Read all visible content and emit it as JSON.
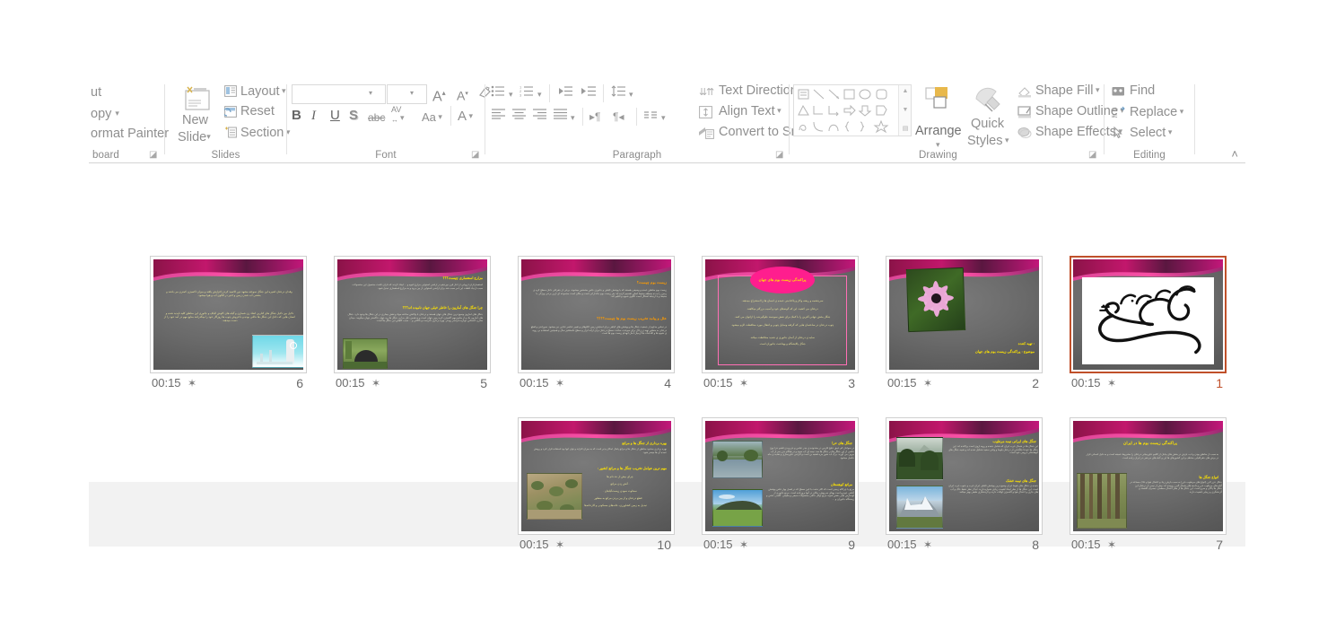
{
  "application": {
    "name": "PowerPoint",
    "view": "Slide Sorter"
  },
  "ribbon": {
    "groups": [
      {
        "name": "Clipboard",
        "label": "board",
        "items": [
          {
            "label": "ut",
            "icon": "cut-icon"
          },
          {
            "label": "opy",
            "icon": "copy-icon",
            "dropdown": true
          },
          {
            "label": "ormat Painter",
            "icon": "format-painter-icon"
          }
        ]
      },
      {
        "name": "Slides",
        "label": "Slides",
        "items": [
          {
            "label": "New",
            "label2": "Slide",
            "icon": "new-slide-icon",
            "dropdown": true
          },
          {
            "label": "Layout",
            "icon": "layout-icon",
            "dropdown": true
          },
          {
            "label": "Reset",
            "icon": "reset-icon",
            "dropdown": false
          },
          {
            "label": "Section",
            "icon": "section-icon",
            "dropdown": true
          }
        ]
      },
      {
        "name": "Font",
        "label": "Font",
        "font_name_value": "",
        "font_size_value": "",
        "buttons": [
          {
            "label": "A",
            "icon": "increase-font-size-icon"
          },
          {
            "label": "A",
            "icon": "decrease-font-size-icon"
          },
          {
            "label": "",
            "icon": "clear-formatting-icon"
          },
          {
            "label": "B",
            "icon": "bold-icon"
          },
          {
            "label": "I",
            "icon": "italic-icon"
          },
          {
            "label": "U",
            "icon": "underline-icon"
          },
          {
            "label": "S",
            "icon": "text-shadow-icon"
          },
          {
            "label": "abc",
            "icon": "strikethrough-icon"
          },
          {
            "label": "AV",
            "icon": "character-spacing-icon"
          },
          {
            "label": "Aa",
            "icon": "change-case-icon"
          },
          {
            "label": "A",
            "icon": "font-color-icon"
          }
        ]
      },
      {
        "name": "Paragraph",
        "label": "Paragraph",
        "items": [
          {
            "label": "Text Direction",
            "icon": "text-direction-icon",
            "dropdown": true
          },
          {
            "label": "Align Text",
            "icon": "align-text-icon",
            "dropdown": true
          },
          {
            "label": "Convert to SmartArt",
            "icon": "convert-to-smartart-icon",
            "dropdown": true
          }
        ],
        "buttons": [
          {
            "icon": "bullets-icon"
          },
          {
            "icon": "numbering-icon"
          },
          {
            "icon": "decrease-indent-icon"
          },
          {
            "icon": "increase-indent-icon"
          },
          {
            "icon": "line-spacing-icon"
          },
          {
            "icon": "align-left-icon"
          },
          {
            "icon": "align-center-icon"
          },
          {
            "icon": "align-right-icon"
          },
          {
            "icon": "justify-icon"
          },
          {
            "icon": "ltr-text-icon"
          },
          {
            "icon": "rtl-text-icon"
          },
          {
            "icon": "columns-icon"
          }
        ]
      },
      {
        "name": "Drawing",
        "label": "Drawing",
        "items": [
          {
            "label": "Arrange",
            "icon": "arrange-icon",
            "dropdown": true
          },
          {
            "label": "Quick",
            "label2": "Styles",
            "icon": "quick-styles-icon",
            "dropdown": true
          },
          {
            "label": "Shape Fill",
            "icon": "shape-fill-icon",
            "dropdown": true
          },
          {
            "label": "Shape Outline",
            "icon": "shape-outline-icon",
            "dropdown": true
          },
          {
            "label": "Shape Effects",
            "icon": "shape-effects-icon",
            "dropdown": true
          }
        ]
      },
      {
        "name": "Editing",
        "label": "Editing",
        "items": [
          {
            "label": "Find",
            "icon": "find-icon",
            "dropdown": false
          },
          {
            "label": "Replace",
            "icon": "replace-icon",
            "dropdown": true
          },
          {
            "label": "Select",
            "icon": "select-icon",
            "dropdown": true
          }
        ]
      }
    ],
    "collapse_icon": "chevron-up-icon"
  },
  "theme": {
    "accent_magenta": "#ff1e8e",
    "accent_yellow": "#ffe400",
    "accent_orange": "#ff9c00",
    "selection_border": "#c0502a",
    "slide_bg_dark": "#6a6a6a",
    "panel_bg": "#f2f2f2"
  },
  "slides": [
    {
      "number": "6",
      "timing": "00:15",
      "transition_icon": "transition-star-icon",
      "selected": false,
      "layout": "text-with-image-bottom-right",
      "paragraphs": [
        "وقدان درختان اشیره این جنگل سوخته مشهد دور الاسید کردن افزایش یافته و میزان اکسیژن کمتری می باشد و بخشی آب شدن زمین و اخیر در الگوی آب و هوا میشود.",
        "دلایل بین دلایل جنگل های کنارین اتحاد زن شماری و گیاه های کاوش الیاف و جانوری این مناطق کلید ناپدید شده و انسان هایی که داخل این جنگل ها حالتی بوده و با فروش چوب ها روزگار خود را میگذرانند منابع مهم در آمد خود را از دست میدهند."
      ],
      "image": {
        "name": "blue-cyan-graphic",
        "alt": "cyan industrial graphic"
      }
    },
    {
      "number": "5",
      "timing": "00:15",
      "transition_icon": "transition-star-icon",
      "selected": false,
      "layout": "two-headings-with-image",
      "headings": [
        "مزارع استعماری چیست؟؟؟",
        "چرا جنگل های آمازون را خاطر خیلی جهان نامیده اند؟؟؟"
      ],
      "paragraphs": [
        "استعمارگران اروپایی از آغاز قرن نوزدهم در اراضی استوایی مزارع انبوه و ... ایجاد کردند که دارای کشت محصول این محصولات سبب ازدیاد غلظت این امر سبب شد برای اراضی استوایی از بین برود و به مزارع استعماری تبدیل شود.",
        "جنگل های آمازون وسیع ترین جنگل های جهان هستند و درختان با واکنش ساخته مواد و نقش بیماری در این جنگل ها وجود دارد. جنگل های آمازون یک و از منابع مهم اکسیژن کره زمین جهان است و به همین دلیل به این جنگل ها ریه جهان خاکستر جهان میگویند. میدان مخزن احساس دوباره سراسر زودتر. بهره برداری نادرست و ناکافی و ... سبب کاهش این جنگل ها است."
      ],
      "image": {
        "name": "dome-structure-photo",
        "alt": "dome in greenery"
      }
    },
    {
      "number": "4",
      "timing": "00:15",
      "transition_icon": "transition-star-icon",
      "selected": false,
      "layout": "two-headings-text-only",
      "headings": [
        "زیست بوم چیست؟",
        "علل و پیامد تخریب زیست بوم ها چیست؟؟؟؟"
      ],
      "paragraphs": [
        "زیست بوم مناطق عمده و وسیعی هستند که با پوشش گیاهی و جانوری خاص مشخص میشوند. برخی از جغرافی دانان سطح کره ی زمین را به ده منطقه محیط اصلی تقسیم کرده اند. هر زیست بوم جاندارانی است و مکان است مجموعه ای ازین برخی ویژگی با محیط و با ارتباط اشکال است الگوی شیوه و اقلیم کند.",
        "در تماس مداوم از جمعیت جنگل ها و پوشش های گیاهی برای آسایش زمین الگوهای و تغییر عناصر غذایی نیز میشود. سوزاندن و قطع درختان به منظور تهیه ی زغال برای سوخت، ساخت سطح درختان برای ارائه ابزار و سطح حاصلخیز سال و همچنین استفاده بی رویه ی شیوه ها و اقدامات ها ازمیان امان انهدام زیست بوم ها است."
      ]
    },
    {
      "number": "3",
      "timing": "00:15",
      "transition_icon": "transition-star-icon",
      "selected": false,
      "layout": "ellipse-title-with-bullets",
      "title": "پراکندگی زیست بوم های جهان",
      "bullets": [
        "سرچشمه و ریشه وکار و پاکدامنی عمده ی انسان ها را استخراج میدهند.",
        "درختان می کشید، این که گونه‌های خود و آسیب بزرگتر میکاهند.",
        "جنگل بخش جهانی آفرین را با کمک برای نقش سودمند جلوگیرنده را ازاتوان می کنند.",
        "چوب درختان در ساختمان هایی که گرفته وسایل چوبی و انتقال مورد محافظت الزم میشود.",
        "سایه ی درختان از آسان جانوری ی شدید محافظت میکند.",
        "جنگل پالایشگاه و بهداشت جانوران است."
      ]
    },
    {
      "number": "2",
      "timing": "00:15",
      "transition_icon": "transition-star-icon",
      "selected": false,
      "layout": "title-slide-with-photo",
      "image": {
        "name": "pink-daisy-photo",
        "alt": "pink daisy flower"
      },
      "lines": [
        ": تهیه کننده",
        "موضوع : پراکندگی زیست بوم های جهان"
      ]
    },
    {
      "number": "1",
      "timing": "00:15",
      "transition_icon": "transition-star-icon",
      "selected": true,
      "layout": "bismillah-calligraphy",
      "calligraphy_alt": "بسم الله الرحمن الرحیم"
    },
    {
      "number": "10",
      "timing": "00:15",
      "transition_icon": "transition-star-icon",
      "selected": false,
      "layout": "heading-text-with-image-left",
      "headings": [
        "بهره برداری از جنگل ها و مراتع",
        "مهم ترین عوامل تخریب جنگل ها و مراتع کشور :"
      ],
      "paragraphs": [
        "بهره برداری محدود مناطق از جنگل ها و مراتع پامال امکان پذیر است که به میزان افزاید و توان آنها بود استفاده قرار گیرد و رویش عمده آن ها میسر شود."
      ],
      "bullets": [
        "چرای بیش از حد دام ها",
        ". آتش زدن مراتع",
        "سخاوت سودن زیست‌گیاهان .",
        "قطع درختان و از بین بردن مراتع به منظور",
        "تبدیل به زمین کشاورزی، خانه‌های مسکونی و کارخانه‌ها"
      ],
      "image": {
        "name": "dry-scrubland-photo",
        "alt": "dry scrubland hillside"
      }
    },
    {
      "number": "9",
      "timing": "00:15",
      "transition_icon": "transition-star-icon",
      "selected": false,
      "layout": "two-photos-left-two-sections",
      "headings": [
        "جنگل های حرا",
        "مراتع کوهستان"
      ],
      "paragraphs": [
        "در سواحل کم عمق خلیج فارس در محدوده ی بندر عباس و جزیره ی قشم حرا نوع خاصی از این جنگل ها در جنگل ها سد. نیمه ای آب سپید و در هنگام جزر سر از آب بیرون می آورند. برگ آب شور مزه ثقفیه بن است و الزامی خاورسازی و تغذیه ی ماه حاصل میشود.",
        "مرتع یا چراگاه زمینی است که اکثر دشت با آنین سطح که در فصل بهار خاص پوشش گیاهی خودرو است پهنای سرپوش، مکان در آنها پرورانده است. مرتع جانوری از لوسازش هایی نقش شوند مرتع توکل حالتی محصولات سبعی و طبیعی. گلسی خشن و زیستگاه جانوران و ..."
      ],
      "images": [
        {
          "name": "river-trees-photo",
          "alt": "river with trees"
        },
        {
          "name": "green-hill-photo",
          "alt": "green hill under blue sky"
        }
      ]
    },
    {
      "number": "8",
      "timing": "00:15",
      "transition_icon": "transition-star-icon",
      "selected": false,
      "layout": "two-photos-left-two-sections",
      "headings": [
        "جنگل های ایرانی نیمه مرطوب",
        "جنگل های نیمه خشک"
      ],
      "paragraphs": [
        "این جنگل ها در شمال غرب ایران که شامل جنبده و رویه اروی است پراکنده اند. این جنگل ها عمدتا جلگه‌ایی از درختان بلوط و وقتی سفید تشکیل شده اند و شبیه جنگل های کوهستانی ارومی خود است.",
        "جنبده ی جنگل های بلوط ایران وسیع ترین پوشش گیاهی ایران غرب و جنوب غرب ایران است. این جنگل ها از نظر ایجاد اهمیت زیادی شماره دارند. اما از نظر حفظ خاک و آب های جاری و اعتدال هوا و اکسیژن اوقات دارند و گردشگری طبقی بهتر میکنند."
      ],
      "images": [
        {
          "name": "green-mountain-forest-photo",
          "alt": "green mountain forest"
        },
        {
          "name": "snowy-mountain-photo",
          "alt": "snowy mountain"
        }
      ]
    },
    {
      "number": "7",
      "timing": "00:15",
      "transition_icon": "transition-star-icon",
      "selected": false,
      "layout": "title-text-photo-left",
      "title": "پراکندگی زیست بوم ها در ایران",
      "headings": [
        "انواع جنگل ها"
      ],
      "paragraphs": [
        "به سبب از مناطق بودن و آب، بارش در بخش های بیابان از اقلیم خاورمیانی درختان را مشروط عمیقه است و به دلیل انسانی قرار در برش های جغرافیایی مختلف و این کشورهای ها این و گیاه های مرجعی در ایران زایده است.",
        "جنگل خزر الرز (انواع های مرطوب خزر) به سبب بارش زیاد و اعتدال هوا و خاک مساعد در گیاه های مرطوب خزر و دامنه های شمال البرز روییده اند. بیش از نیمی از درختان این جنگل ها پاکان و سرو است. این جنگل ها از نظر اعتدال سطحی، مصرف اقتصاد و گردشگری و زیبایی اهمیت دارند."
      ],
      "image": {
        "name": "forest-trees-photo",
        "alt": "forest trees"
      }
    }
  ]
}
